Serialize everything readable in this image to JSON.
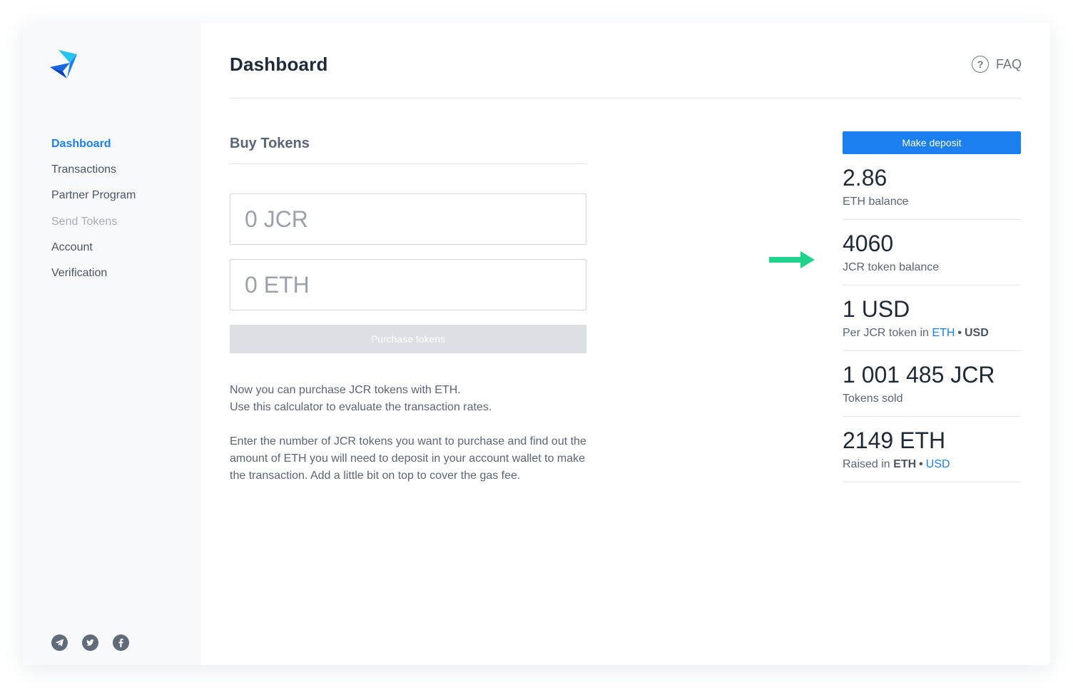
{
  "sidebar": {
    "logo": "logo-icon",
    "nav": [
      {
        "label": "Dashboard",
        "state": "active"
      },
      {
        "label": "Transactions",
        "state": "normal"
      },
      {
        "label": "Partner Program",
        "state": "normal"
      },
      {
        "label": "Send Tokens",
        "state": "disabled"
      },
      {
        "label": "Account",
        "state": "normal"
      },
      {
        "label": "Verification",
        "state": "normal"
      }
    ],
    "social": [
      "telegram-icon",
      "twitter-icon",
      "facebook-icon"
    ]
  },
  "header": {
    "title": "Dashboard",
    "faq_label": "FAQ",
    "faq_icon_glyph": "?"
  },
  "buy": {
    "title": "Buy Tokens",
    "jcr_placeholder": "0 JCR",
    "eth_placeholder": "0 ETH",
    "purchase_label": "Purchase tokens",
    "desc_line1": "Now you can purchase JCR tokens with ETH.",
    "desc_line2": "Use this calculator to evaluate the transaction rates.",
    "desc_para2": "Enter the number of JCR tokens you want to purchase and find out the amount of ETH you will need to deposit in your account wallet to make the transaction. Add a little bit on top to cover the gas fee."
  },
  "stats": {
    "deposit_label": "Make deposit",
    "eth_balance": {
      "value": "2.86",
      "label": "ETH balance"
    },
    "jcr_balance": {
      "value": "4060",
      "label": "JCR token balance"
    },
    "price": {
      "value": "1 USD",
      "label_prefix": "Per JCR token in",
      "opt1": "ETH",
      "sep": "•",
      "opt2": "USD"
    },
    "sold": {
      "value": "1 001 485 JCR",
      "label": "Tokens sold"
    },
    "raised": {
      "value": "2149 ETH",
      "label_prefix": "Raised in",
      "opt1": "ETH",
      "sep": "•",
      "opt2": "USD"
    }
  },
  "colors": {
    "accent": "#1b7ff0",
    "arrow": "#1fd38a",
    "text": "#1f2a37",
    "muted": "#5b6573",
    "disabled_button": "#dcdfe3"
  }
}
